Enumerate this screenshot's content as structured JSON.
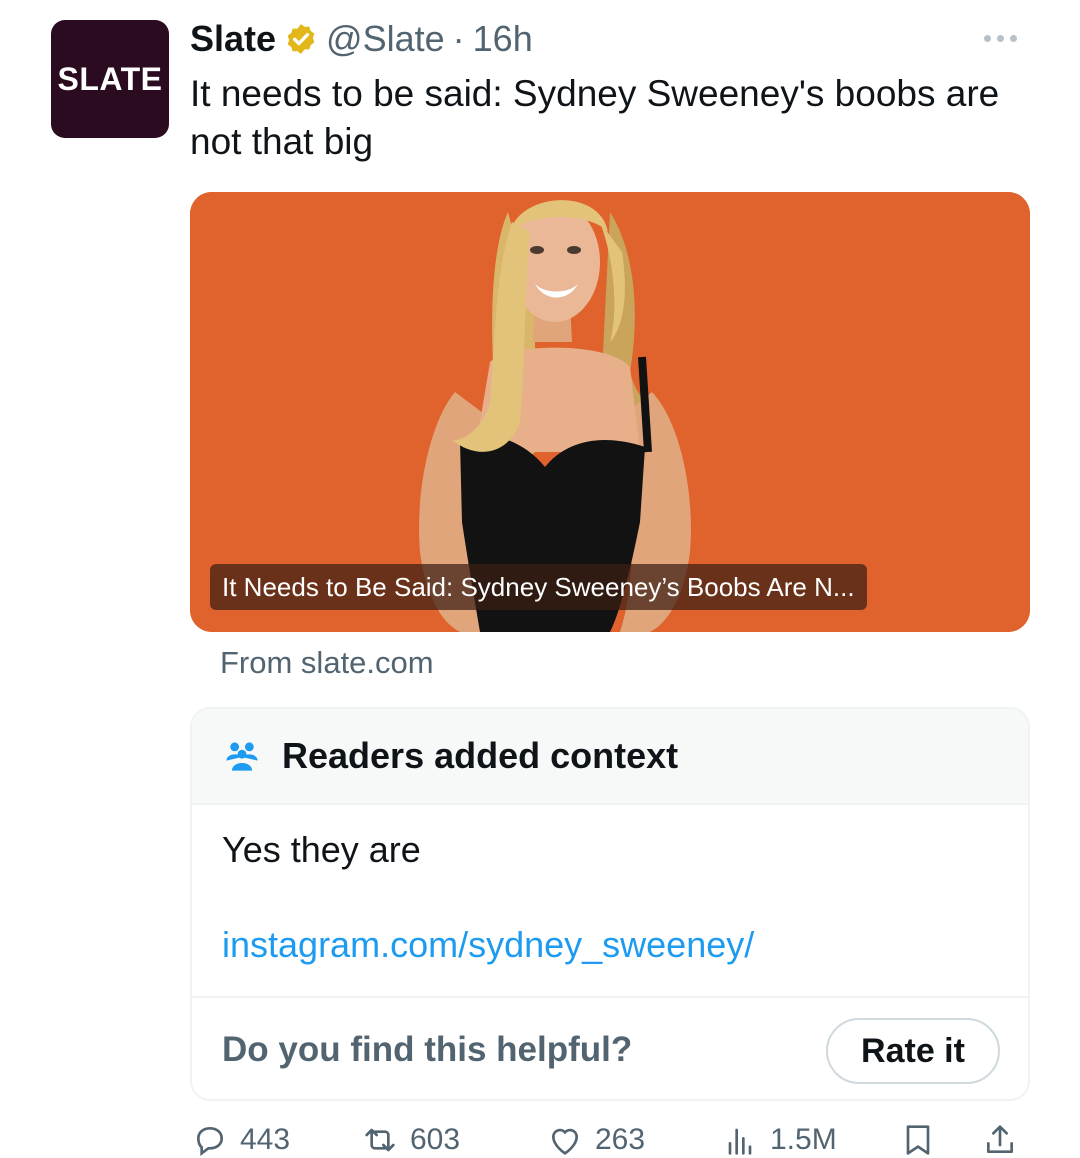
{
  "author": {
    "avatar_text": "SLATE",
    "name": "Slate",
    "handle": "@Slate",
    "separator": "·",
    "time": "16h"
  },
  "tweet": {
    "text": "It needs to be said: Sydney Sweeney's boobs are not that big"
  },
  "card": {
    "title": "It Needs to Be Said: Sydney Sweeney’s Boobs Are N...",
    "source": "From slate.com",
    "background_color": "#e0622c"
  },
  "context": {
    "header": "Readers added context",
    "body": "Yes they are",
    "link": "instagram.com/sydney_sweeney/",
    "question": "Do you find this helpful?",
    "rate_label": "Rate it"
  },
  "actions": {
    "replies": "443",
    "reposts": "603",
    "likes": "263",
    "views": "1.5M"
  },
  "colors": {
    "accent": "#1d9bf0",
    "verified_badge": "#e2b719",
    "avatar_bg": "#2a0b1f"
  }
}
